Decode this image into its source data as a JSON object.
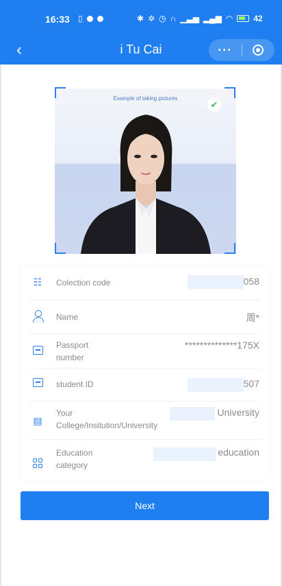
{
  "status_bar": {
    "time": "16:33",
    "battery": "42"
  },
  "nav": {
    "title": "i Tu Cai",
    "back_icon": "chevron-left-icon",
    "more_icon": "more-dots-icon",
    "target_icon": "target-icon"
  },
  "photo": {
    "caption": "Example of taking pictures"
  },
  "info": {
    "rows": [
      {
        "label": "Colection code",
        "value": "058",
        "icon": "barcode-icon"
      },
      {
        "label": "Name",
        "value": "周*",
        "icon": "person-icon"
      },
      {
        "label": "Passport number",
        "value": "**************175X",
        "icon": "id-card-icon"
      },
      {
        "label": "student ID",
        "value": "507",
        "icon": "student-id-icon"
      },
      {
        "label": "Your College/Insitution/University",
        "value": "University",
        "icon": "building-icon"
      },
      {
        "label": "Education category",
        "value": "education",
        "icon": "category-grid-icon"
      }
    ]
  },
  "actions": {
    "next_label": "Next"
  },
  "colors": {
    "primary": "#1f7ff0",
    "mask": "#e9f2fd"
  }
}
